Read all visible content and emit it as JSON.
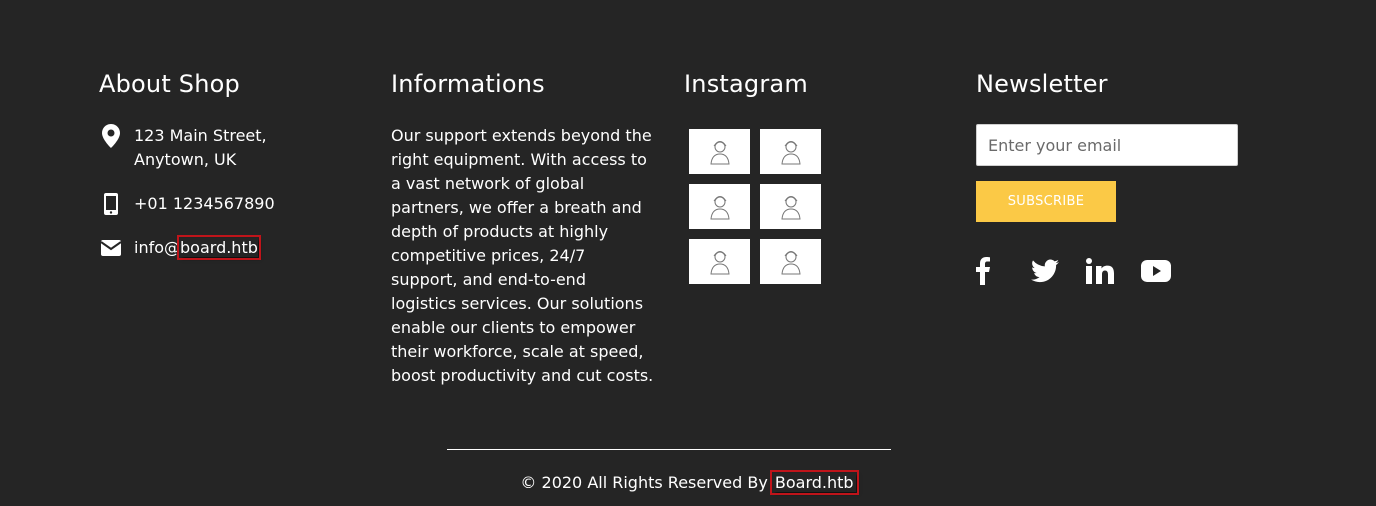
{
  "about": {
    "heading": "About Shop",
    "address_line1": "123 Main Street,",
    "address_line2": "Anytown, UK",
    "phone": "+01 1234567890",
    "email_prefix": "info@",
    "email_domain": "board.htb",
    "icons": [
      "map-pin-icon",
      "mobile-phone-icon",
      "envelope-icon"
    ]
  },
  "info": {
    "heading": "Informations",
    "text": "Our support extends beyond the right equipment. With access to a vast network of global partners, we offer a breath and depth of products at highly competitive prices, 24/7 support, and end-to-end logistics services. Our solutions enable our clients to empower their workforce, scale at speed, boost productivity and cut costs."
  },
  "instagram": {
    "heading": "Instagram",
    "thumbnail_count": 6
  },
  "newsletter": {
    "heading": "Newsletter",
    "email_placeholder": "Enter your email",
    "email_value": "",
    "subscribe_label": "SUBSCRIBE",
    "social_icons": [
      "facebook-icon",
      "twitter-icon",
      "linkedin-icon",
      "youtube-icon"
    ]
  },
  "footer": {
    "copyright_prefix": "© 2020 All Rights Reserved By ",
    "brand": "Board.htb"
  },
  "colors": {
    "background": "#252525",
    "text": "#ffffff",
    "accent": "#fbc946",
    "highlight_box": "#c0141a"
  }
}
